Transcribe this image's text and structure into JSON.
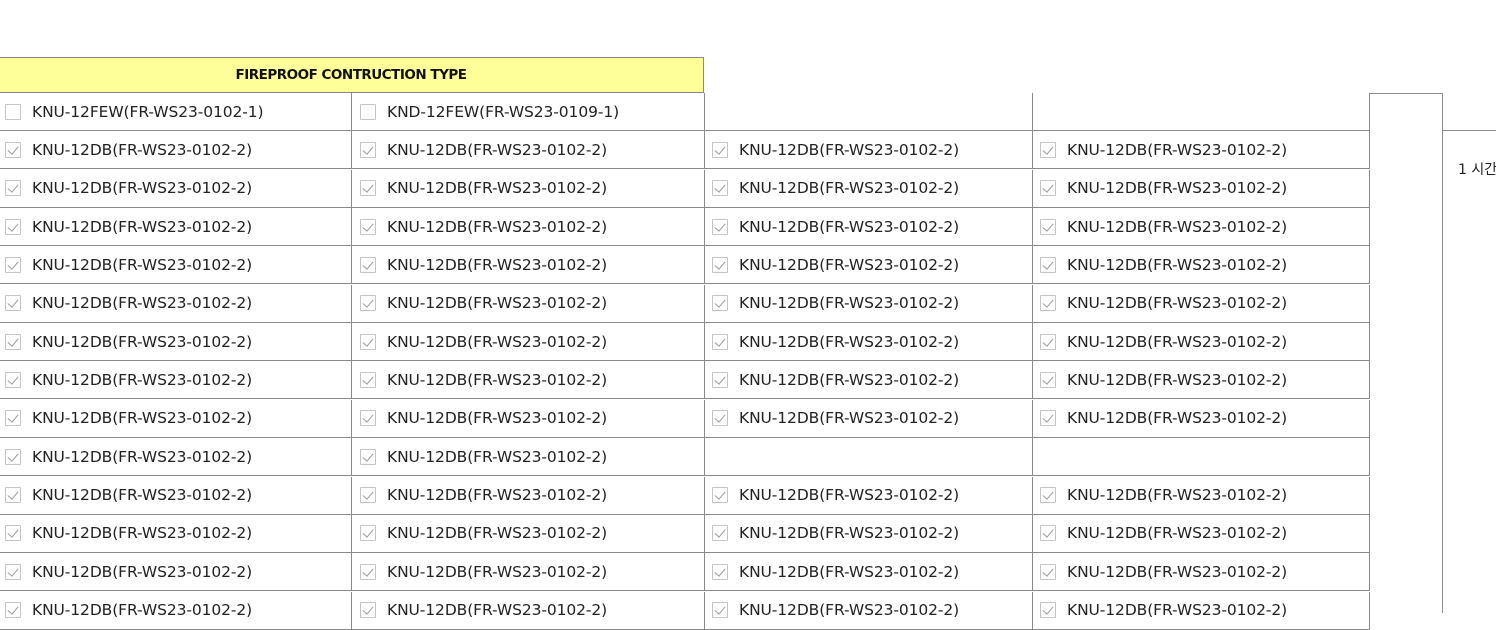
{
  "table": {
    "header": "FIREPROOF CONTRUCTION TYPE",
    "side_label": "1 시간",
    "rows": [
      [
        {
          "label": "KNU-12FEW(FR-WS23-0102-1)",
          "checked": false
        },
        {
          "label": "KND-12FEW(FR-WS23-0109-1)",
          "checked": false
        },
        null,
        null
      ],
      [
        {
          "label": "KNU-12DB(FR-WS23-0102-2)",
          "checked": true
        },
        {
          "label": "KNU-12DB(FR-WS23-0102-2)",
          "checked": true
        },
        {
          "label": "KNU-12DB(FR-WS23-0102-2)",
          "checked": true
        },
        {
          "label": "KNU-12DB(FR-WS23-0102-2)",
          "checked": true
        }
      ],
      [
        {
          "label": "KNU-12DB(FR-WS23-0102-2)",
          "checked": true
        },
        {
          "label": "KNU-12DB(FR-WS23-0102-2)",
          "checked": true
        },
        {
          "label": "KNU-12DB(FR-WS23-0102-2)",
          "checked": true
        },
        {
          "label": "KNU-12DB(FR-WS23-0102-2)",
          "checked": true
        }
      ],
      [
        {
          "label": "KNU-12DB(FR-WS23-0102-2)",
          "checked": true
        },
        {
          "label": "KNU-12DB(FR-WS23-0102-2)",
          "checked": true
        },
        {
          "label": "KNU-12DB(FR-WS23-0102-2)",
          "checked": true
        },
        {
          "label": "KNU-12DB(FR-WS23-0102-2)",
          "checked": true
        }
      ],
      [
        {
          "label": "KNU-12DB(FR-WS23-0102-2)",
          "checked": true
        },
        {
          "label": "KNU-12DB(FR-WS23-0102-2)",
          "checked": true
        },
        {
          "label": "KNU-12DB(FR-WS23-0102-2)",
          "checked": true
        },
        {
          "label": "KNU-12DB(FR-WS23-0102-2)",
          "checked": true
        }
      ],
      [
        {
          "label": "KNU-12DB(FR-WS23-0102-2)",
          "checked": true
        },
        {
          "label": "KNU-12DB(FR-WS23-0102-2)",
          "checked": true
        },
        {
          "label": "KNU-12DB(FR-WS23-0102-2)",
          "checked": true
        },
        {
          "label": "KNU-12DB(FR-WS23-0102-2)",
          "checked": true
        }
      ],
      [
        {
          "label": "KNU-12DB(FR-WS23-0102-2)",
          "checked": true
        },
        {
          "label": "KNU-12DB(FR-WS23-0102-2)",
          "checked": true
        },
        {
          "label": "KNU-12DB(FR-WS23-0102-2)",
          "checked": true
        },
        {
          "label": "KNU-12DB(FR-WS23-0102-2)",
          "checked": true
        }
      ],
      [
        {
          "label": "KNU-12DB(FR-WS23-0102-2)",
          "checked": true
        },
        {
          "label": "KNU-12DB(FR-WS23-0102-2)",
          "checked": true
        },
        {
          "label": "KNU-12DB(FR-WS23-0102-2)",
          "checked": true
        },
        {
          "label": "KNU-12DB(FR-WS23-0102-2)",
          "checked": true
        }
      ],
      [
        {
          "label": "KNU-12DB(FR-WS23-0102-2)",
          "checked": true
        },
        {
          "label": "KNU-12DB(FR-WS23-0102-2)",
          "checked": true
        },
        {
          "label": "KNU-12DB(FR-WS23-0102-2)",
          "checked": true
        },
        {
          "label": "KNU-12DB(FR-WS23-0102-2)",
          "checked": true
        }
      ],
      [
        {
          "label": "KNU-12DB(FR-WS23-0102-2)",
          "checked": true
        },
        {
          "label": "KNU-12DB(FR-WS23-0102-2)",
          "checked": true
        },
        null,
        null
      ],
      [
        {
          "label": "KNU-12DB(FR-WS23-0102-2)",
          "checked": true
        },
        {
          "label": "KNU-12DB(FR-WS23-0102-2)",
          "checked": true
        },
        {
          "label": "KNU-12DB(FR-WS23-0102-2)",
          "checked": true
        },
        {
          "label": "KNU-12DB(FR-WS23-0102-2)",
          "checked": true
        }
      ],
      [
        {
          "label": "KNU-12DB(FR-WS23-0102-2)",
          "checked": true
        },
        {
          "label": "KNU-12DB(FR-WS23-0102-2)",
          "checked": true
        },
        {
          "label": "KNU-12DB(FR-WS23-0102-2)",
          "checked": true
        },
        {
          "label": "KNU-12DB(FR-WS23-0102-2)",
          "checked": true
        }
      ],
      [
        {
          "label": "KNU-12DB(FR-WS23-0102-2)",
          "checked": true
        },
        {
          "label": "KNU-12DB(FR-WS23-0102-2)",
          "checked": true
        },
        {
          "label": "KNU-12DB(FR-WS23-0102-2)",
          "checked": true
        },
        {
          "label": "KNU-12DB(FR-WS23-0102-2)",
          "checked": true
        }
      ],
      [
        {
          "label": "KNU-12DB(FR-WS23-0102-2)",
          "checked": true
        },
        {
          "label": "KNU-12DB(FR-WS23-0102-2)",
          "checked": true
        },
        {
          "label": "KNU-12DB(FR-WS23-0102-2)",
          "checked": true
        },
        {
          "label": "KNU-12DB(FR-WS23-0102-2)",
          "checked": true
        }
      ]
    ]
  }
}
